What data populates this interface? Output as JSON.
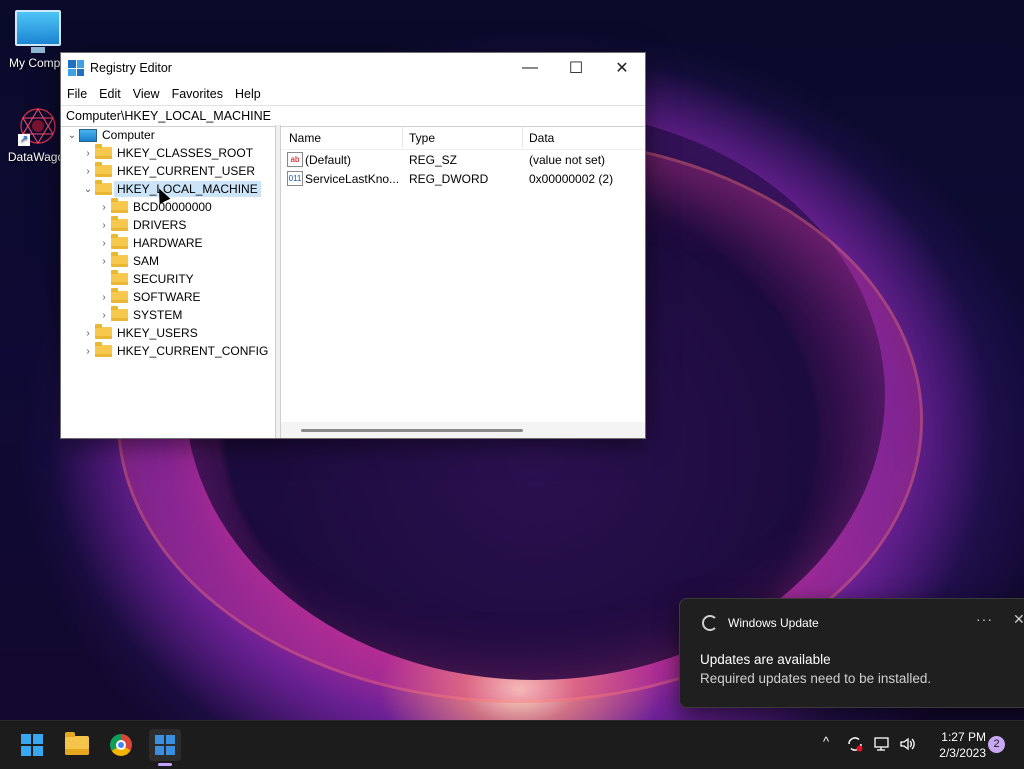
{
  "desktop": {
    "icons": [
      {
        "label": "My Compu"
      },
      {
        "label": "DataWagor"
      }
    ]
  },
  "window": {
    "title": "Registry Editor",
    "controls": {
      "minimize": "—",
      "maximize": "☐",
      "close": "✕"
    },
    "menu": [
      "File",
      "Edit",
      "View",
      "Favorites",
      "Help"
    ],
    "address": "Computer\\HKEY_LOCAL_MACHINE",
    "tree": {
      "root": "Computer",
      "hives": [
        "HKEY_CLASSES_ROOT",
        "HKEY_CURRENT_USER",
        "HKEY_LOCAL_MACHINE",
        "HKEY_USERS",
        "HKEY_CURRENT_CONFIG"
      ],
      "hklm_children": [
        "BCD00000000",
        "DRIVERS",
        "HARDWARE",
        "SAM",
        "SECURITY",
        "SOFTWARE",
        "SYSTEM"
      ],
      "selected": "HKEY_LOCAL_MACHINE"
    },
    "list": {
      "columns": [
        "Name",
        "Type",
        "Data"
      ],
      "rows": [
        {
          "icon": "ab",
          "name": "(Default)",
          "type": "REG_SZ",
          "data": "(value not set)"
        },
        {
          "icon": "011",
          "name": "ServiceLastKno...",
          "type": "REG_DWORD",
          "data": "0x00000002 (2)"
        }
      ]
    }
  },
  "notification": {
    "app": "Windows Update",
    "more": "···",
    "close": "✕",
    "title": "Updates are available",
    "body": "Required updates need to be installed."
  },
  "taskbar": {
    "tray": {
      "chevron": "^"
    },
    "time": "1:27 PM",
    "date": "2/3/2023",
    "badge": "2"
  }
}
